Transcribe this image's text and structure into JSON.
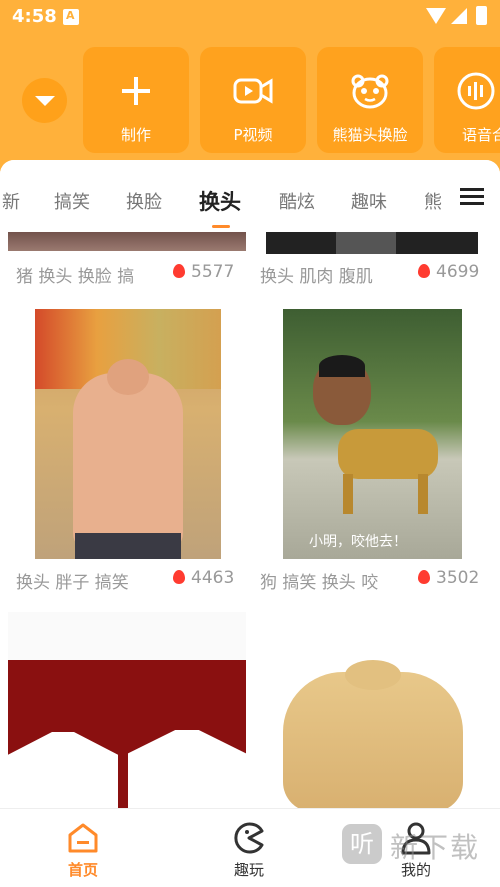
{
  "status": {
    "time": "4:58"
  },
  "tools": [
    {
      "label": "制作",
      "icon": "plus-icon"
    },
    {
      "label": "P视频",
      "icon": "video-camera-icon"
    },
    {
      "label": "熊猫头换脸",
      "icon": "panda-face-icon"
    },
    {
      "label": "语音合",
      "icon": "voice-wave-icon"
    }
  ],
  "tabs": [
    "新",
    "搞笑",
    "换脸",
    "换头",
    "酷炫",
    "趣味",
    "熊"
  ],
  "active_tab": "换头",
  "feed": [
    {
      "tags": "猪 换头 换脸 搞",
      "hot": "5577"
    },
    {
      "tags": "换头 肌肉 腹肌",
      "hot": "4699"
    },
    {
      "tags": "换头 胖子 搞笑",
      "hot": "4463"
    },
    {
      "tags": "狗 搞笑 换头 咬",
      "hot": "3502",
      "caption": "小明，咬他去！"
    }
  ],
  "bottom_nav": [
    {
      "label": "首页",
      "icon": "home-icon",
      "active": true
    },
    {
      "label": "趣玩",
      "icon": "pacman-icon",
      "active": false
    },
    {
      "label": "我的",
      "icon": "user-icon",
      "active": false
    }
  ],
  "watermark": {
    "logo": "听",
    "text": "新下载"
  },
  "colors": {
    "header": "#ffb13b",
    "tool_tile": "#ffa21e",
    "accent": "#ff8a2a",
    "hot": "#ff3b30"
  }
}
